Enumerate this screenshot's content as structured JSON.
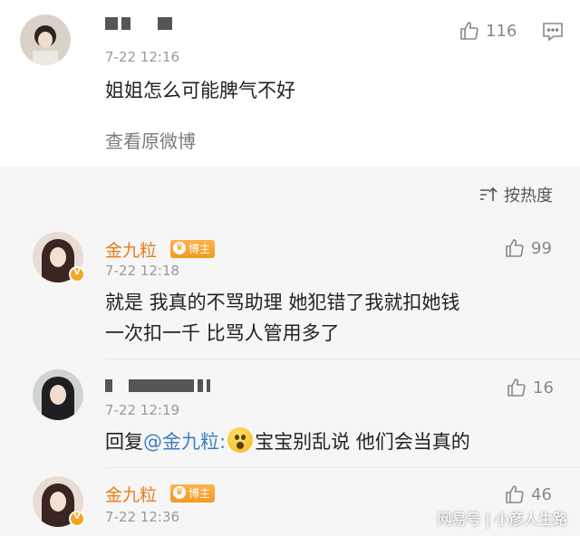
{
  "post": {
    "author_masked": "",
    "time": "7-22 12:16",
    "likes": "116",
    "text": "姐姐怎么可能脾气不好",
    "view_original": "查看原微博"
  },
  "sort": {
    "label": "按热度"
  },
  "comments": [
    {
      "author": "金九粒",
      "tag": "博主",
      "time": "7-22 12:18",
      "likes": "99",
      "line1": "就是 我真的不骂助理 她犯错了我就扣她钱",
      "line2": "一次扣一千 比骂人管用多了"
    },
    {
      "author_masked": "",
      "time": "7-22 12:19",
      "likes": "16",
      "reply_prefix": "回复",
      "mention": "@金九粒:",
      "reply_text": "宝宝别乱说 他们会当真的"
    },
    {
      "author": "金九粒",
      "tag": "博主",
      "time": "7-22 12:36",
      "likes": "46"
    }
  ],
  "watermark": "网易号 | 小彦人生路",
  "icons": {
    "like": "thumbs-up-icon",
    "comment": "comment-icon",
    "sort": "sort-icon",
    "verified": "verified-v-icon"
  },
  "colors": {
    "name_orange": "#e87b1c",
    "tag_orange": "#f29a1f",
    "mention_blue": "#3d7dc4",
    "gray_band": "#f6f6f6"
  }
}
